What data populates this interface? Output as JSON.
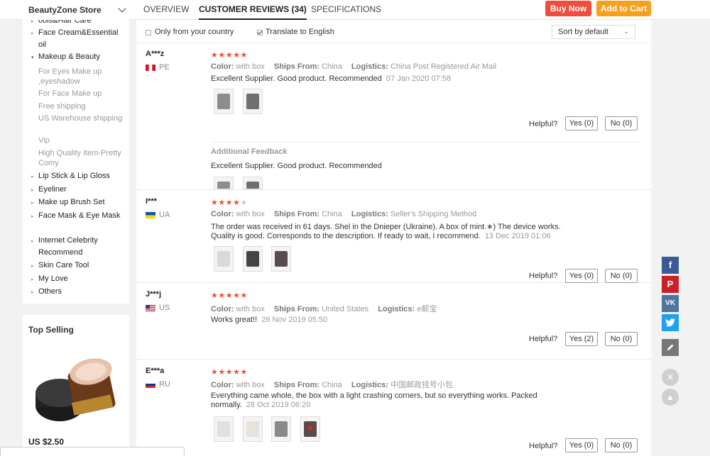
{
  "header": {
    "store_name": "BeautyZone Store",
    "tabs": [
      {
        "label": "OVERVIEW"
      },
      {
        "label": "CUSTOMER REVIEWS (34)"
      },
      {
        "label": "SPECIFICATIONS"
      }
    ],
    "buy_now": "Buy Now",
    "add_to_cart": "Add to Cart",
    "buy_now_color": "#f24c3a",
    "add_to_cart_color": "#f7a01d"
  },
  "sidebar": {
    "items": [
      {
        "label": "ools&Hair Care"
      },
      {
        "label": "Face Cream&Essential oil"
      },
      {
        "label": "Makeup & Beauty"
      },
      {
        "label": "Lip Stick & Lip Gloss"
      },
      {
        "label": "Eyeliner"
      },
      {
        "label": "Make up Brush Set"
      },
      {
        "label": "Face Mask & Eye Mask"
      },
      {
        "label": "Internet Celebrity Recommend"
      },
      {
        "label": "Skin Care Tool"
      },
      {
        "label": "My Love"
      },
      {
        "label": "Others"
      }
    ],
    "subitems": [
      {
        "label": "For Eyes Make up ,eyeshadow"
      },
      {
        "label": "For Face Make up"
      },
      {
        "label": "Free shipping"
      },
      {
        "label": "US Warehouse shipping"
      },
      {
        "label": "Vip"
      },
      {
        "label": "High Quality Item-Pretty Comy"
      }
    ],
    "top_selling": {
      "title": "Top Selling",
      "price": "US $2.50"
    }
  },
  "filters": {
    "only_country": "Only from your country",
    "only_country_checked": false,
    "translate": "Translate to English",
    "translate_checked": true,
    "sort": "Sort by default"
  },
  "review_labels": {
    "color": "Color:",
    "ships_from": "Ships From:",
    "logistics": "Logistics:",
    "helpful": "Helpful?",
    "additional_feedback": "Additional Feedback"
  },
  "reviews": [
    {
      "user": "A***z",
      "country": "PE",
      "stars": 5,
      "color": "with box",
      "ships_from": "China",
      "logistics": "China Post Registered Air Mail",
      "text": "Excellent Supplier. Good product. Recommended",
      "date": "07 Jan 2020 07:58",
      "additional_text": "Excellent Supplier. Good product. Recommended",
      "yes": "Yes (0)",
      "no": "No (0)"
    },
    {
      "user": "I***",
      "country": "UA",
      "stars": 4,
      "color": "with box",
      "ships_from": "China",
      "logistics": "Seller's Shipping Method",
      "text1": "The order was received in 61 days. Shel in the Dnieper (Ukraine). A box of mint.∗) The device works.",
      "text2": "Quality is good. Corresponds to the description. If ready to wait, I recommend.",
      "date": "13 Dec 2019 01:06",
      "yes": "Yes (0)",
      "no": "No (0)"
    },
    {
      "user": "J***j",
      "country": "US",
      "stars": 5,
      "color": "with box",
      "ships_from": "United States",
      "logistics": "e邮宝",
      "text": "Works great!!",
      "date": "26 Nov 2019 05:50",
      "yes": "Yes (2)",
      "no": "No (0)"
    },
    {
      "user": "E***a",
      "country": "RU",
      "stars": 5,
      "color": "with box",
      "ships_from": "China",
      "logistics": "中国邮政挂号小包",
      "text1": "Everything came whole, the box with a light crashing corners, but so everything works. Packed",
      "text2": "normally.",
      "date": "28 Oct 2019 06:20",
      "yes": "Yes (0)",
      "no": "No (0)"
    }
  ],
  "social": {
    "facebook_color": "#3b5998",
    "pinterest_color": "#cb2027",
    "vk_color": "#4c75a3",
    "twitter_color": "#1da1f2",
    "edit_color": "#777777"
  }
}
